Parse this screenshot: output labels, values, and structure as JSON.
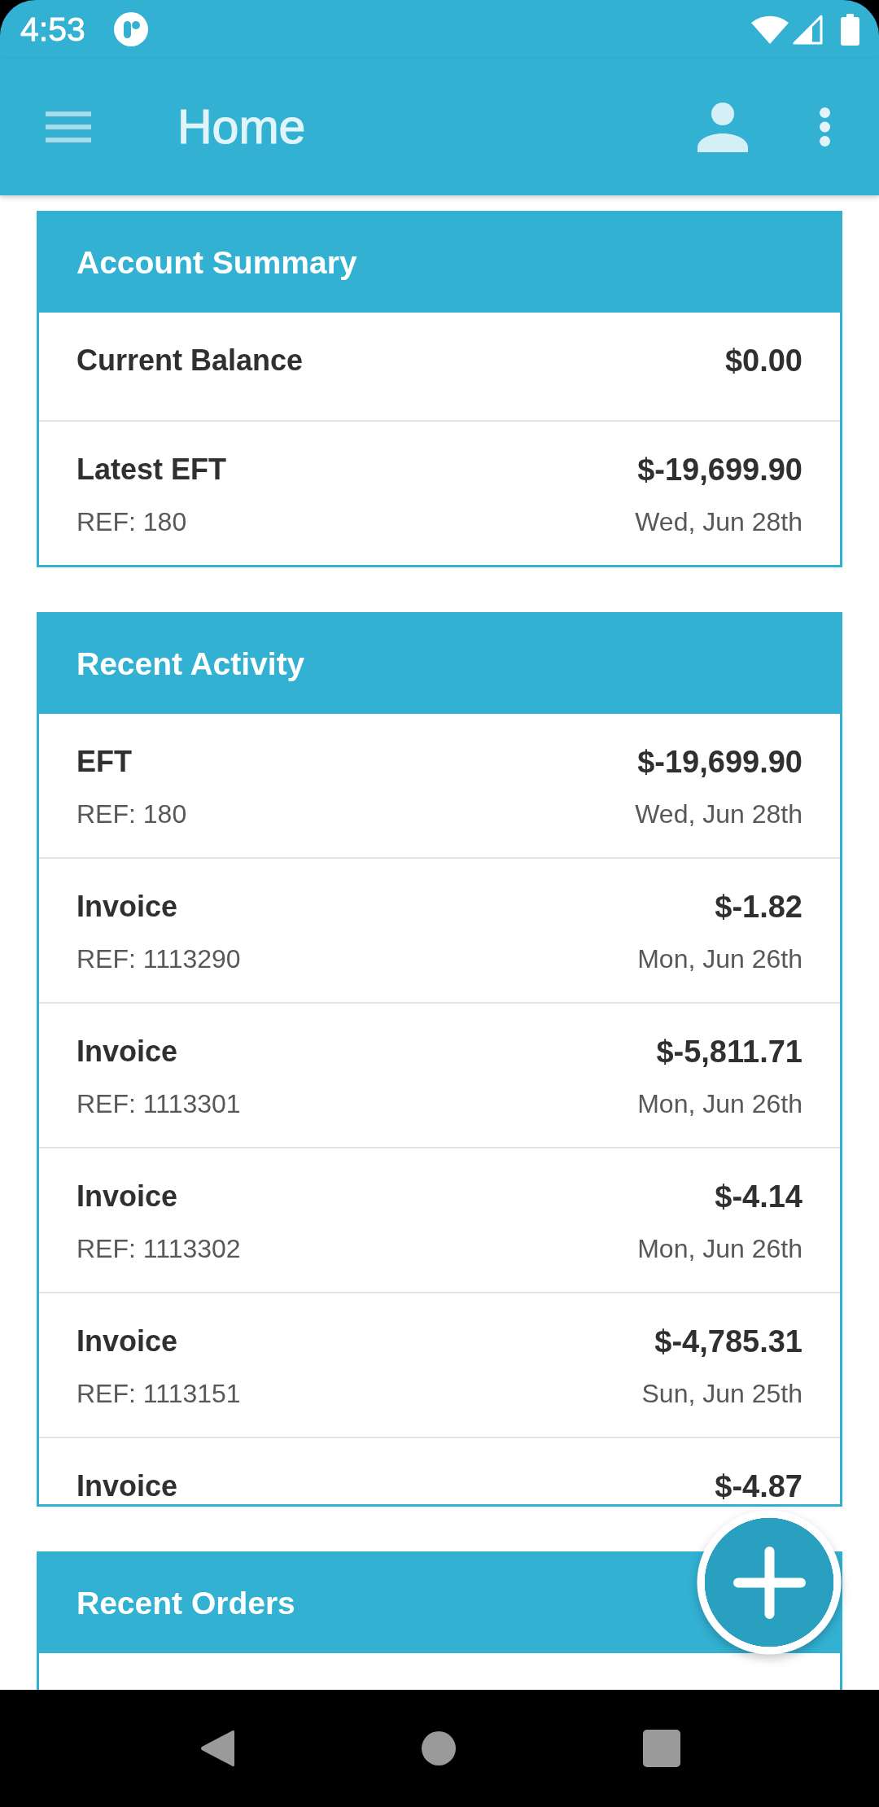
{
  "status_bar": {
    "time": "4:53"
  },
  "app_bar": {
    "title": "Home"
  },
  "cards": [
    {
      "title": "Account Summary",
      "rows": [
        {
          "label": "Current Balance",
          "amount": "$0.00"
        },
        {
          "label": "Latest EFT",
          "amount": "$-19,699.90",
          "ref": "REF: 180",
          "date": "Wed, Jun 28th"
        }
      ]
    },
    {
      "title": "Recent Activity",
      "rows": [
        {
          "label": "EFT",
          "amount": "$-19,699.90",
          "ref": "REF: 180",
          "date": "Wed, Jun 28th"
        },
        {
          "label": "Invoice",
          "amount": "$-1.82",
          "ref": "REF: 1113290",
          "date": "Mon, Jun 26th"
        },
        {
          "label": "Invoice",
          "amount": "$-5,811.71",
          "ref": "REF: 1113301",
          "date": "Mon, Jun 26th"
        },
        {
          "label": "Invoice",
          "amount": "$-4.14",
          "ref": "REF: 1113302",
          "date": "Mon, Jun 26th"
        },
        {
          "label": "Invoice",
          "amount": "$-4,785.31",
          "ref": "REF: 1113151",
          "date": "Sun, Jun 25th"
        },
        {
          "label": "Invoice",
          "amount": "$-4.87"
        }
      ]
    },
    {
      "title": "Recent Orders"
    }
  ]
}
